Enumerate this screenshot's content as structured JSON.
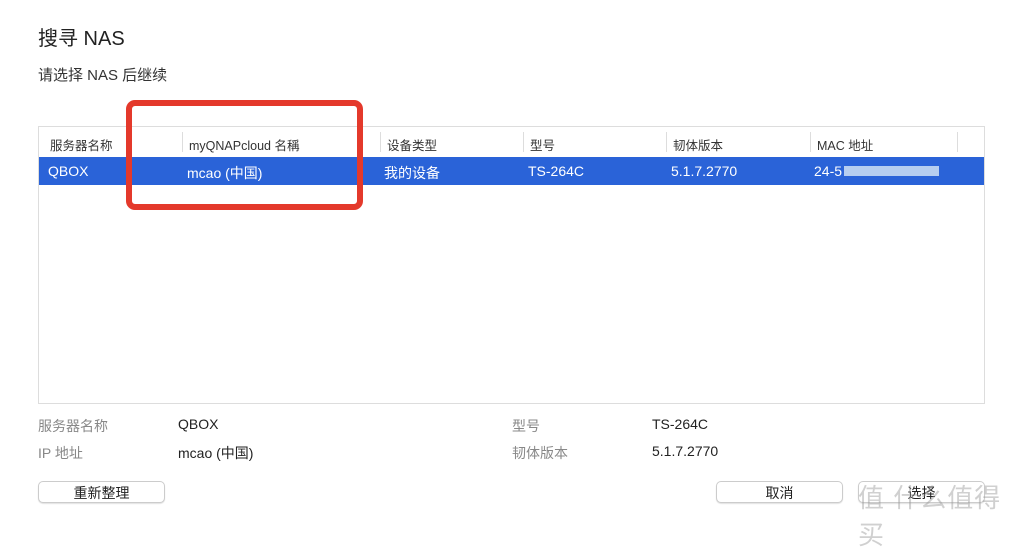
{
  "title": "搜寻 NAS",
  "subtitle": "请选择 NAS 后继续",
  "table": {
    "headers": [
      "服务器名称",
      "myQNAPcloud 名稱",
      "设备类型",
      "型号",
      "韧体版本",
      "MAC 地址"
    ],
    "rows": [
      {
        "server": "QBOX",
        "cloud": "mcao (中国)",
        "type": "我的设备",
        "model": "TS-264C",
        "firmware": "5.1.7.2770",
        "mac": "24-5"
      }
    ]
  },
  "details": {
    "server_label": "服务器名称",
    "server_value": "QBOX",
    "ip_label": "IP 地址",
    "ip_value": "mcao (中国)",
    "model_label": "型号",
    "model_value": "TS-264C",
    "firmware_label": "韧体版本",
    "firmware_value": "5.1.7.2770"
  },
  "buttons": {
    "refresh": "重新整理",
    "cancel": "取消",
    "select": "选择"
  },
  "watermark": "值 什么值得买",
  "colors": {
    "selection": "#2a63d8",
    "highlight": "#e4392b"
  }
}
